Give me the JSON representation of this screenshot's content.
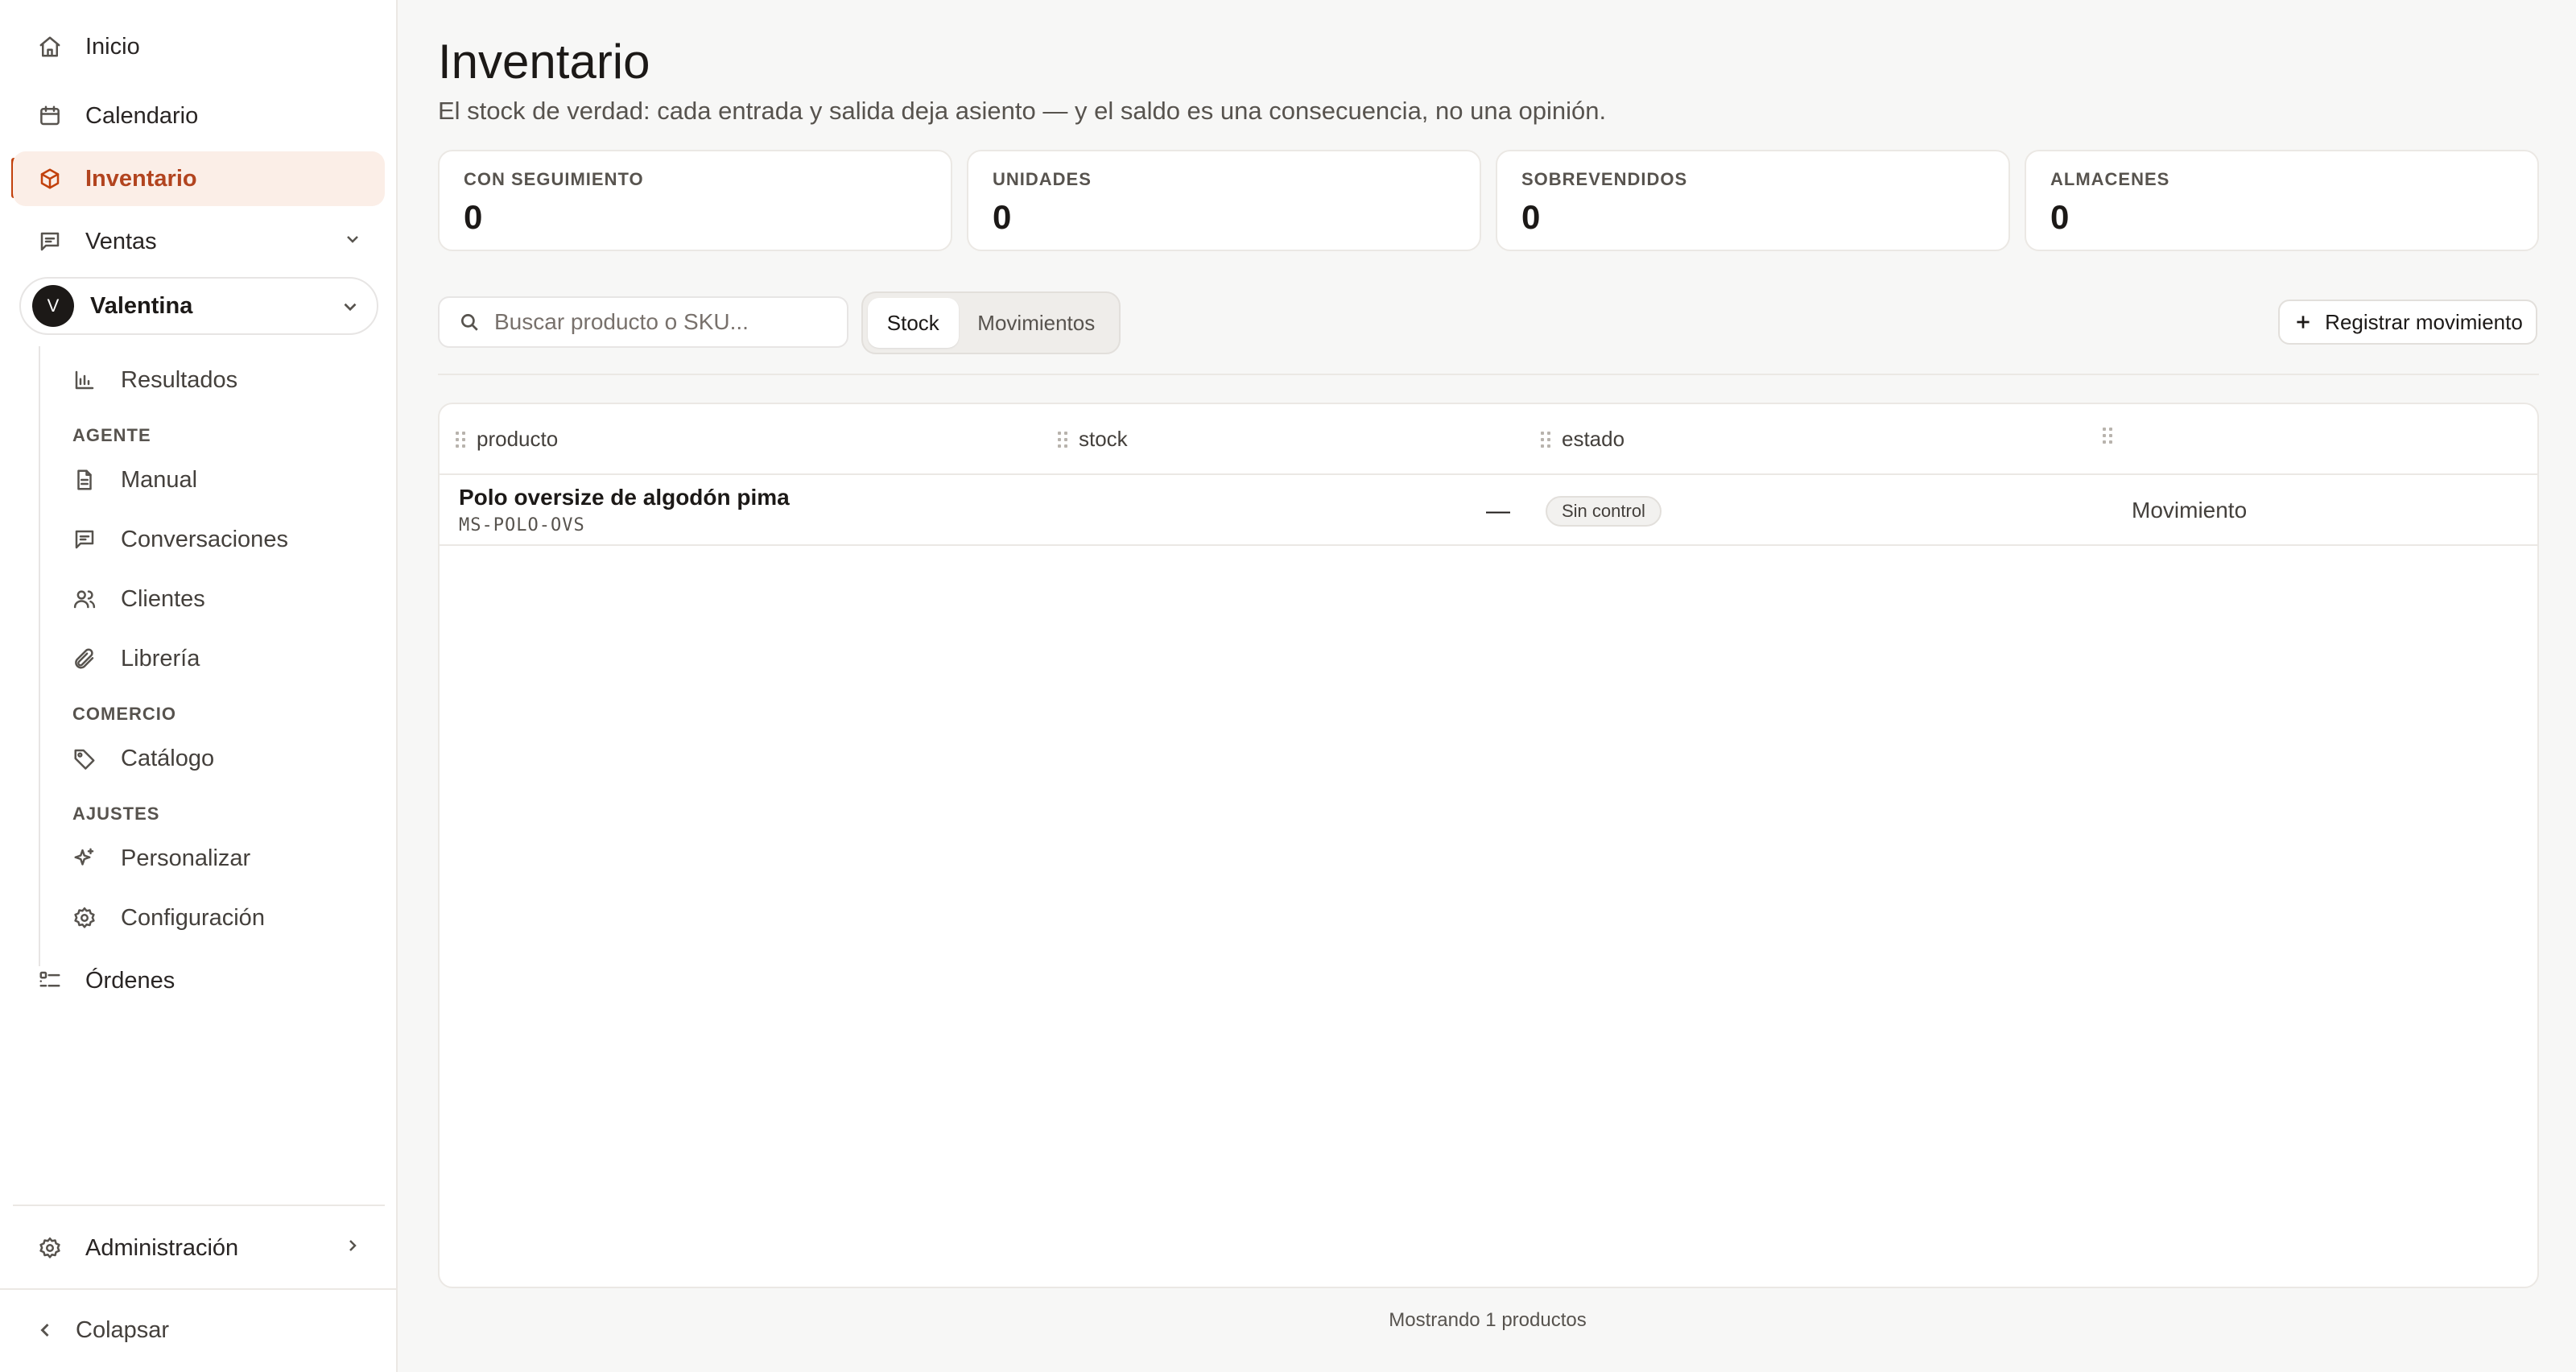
{
  "sidebar": {
    "items": [
      {
        "label": "Inicio",
        "icon": "home-icon"
      },
      {
        "label": "Calendario",
        "icon": "calendar-icon"
      },
      {
        "label": "Inventario",
        "icon": "box-icon",
        "active": true
      },
      {
        "label": "Ventas",
        "icon": "message-icon"
      }
    ],
    "account": {
      "initial": "V",
      "name": "Valentina"
    },
    "sub_items": {
      "resultados": "Resultados",
      "manual": "Manual",
      "conversaciones": "Conversaciones",
      "clientes": "Clientes",
      "libreria": "Librería",
      "catalogo": "Catálogo",
      "personalizar": "Personalizar",
      "configuracion": "Configuración"
    },
    "sections": {
      "agente": "AGENTE",
      "comercio": "COMERCIO",
      "ajustes": "AJUSTES"
    },
    "ordenes": "Órdenes",
    "administracion": "Administración",
    "colapsar": "Colapsar"
  },
  "header": {
    "title": "Inventario",
    "subtitle": "El stock de verdad: cada entrada y salida deja asiento — y el saldo es una consecuencia, no una opinión."
  },
  "stats": [
    {
      "label": "CON SEGUIMIENTO",
      "value": "0"
    },
    {
      "label": "UNIDADES",
      "value": "0"
    },
    {
      "label": "SOBREVENDIDOS",
      "value": "0"
    },
    {
      "label": "ALMACENES",
      "value": "0"
    }
  ],
  "toolbar": {
    "search_placeholder": "Buscar producto o SKU...",
    "tabs": [
      "Stock",
      "Movimientos"
    ],
    "register_label": "Registrar movimiento"
  },
  "table": {
    "columns": [
      "producto",
      "stock",
      "estado",
      ""
    ],
    "rows": [
      {
        "name": "Polo oversize de algodón pima",
        "sku": "MS-POLO-OVS",
        "stock": "—",
        "status": "Sin control",
        "action": "Movimiento"
      }
    ]
  },
  "footer": {
    "text": "Mostrando 1 productos"
  },
  "colors": {
    "accent": "#c2410c",
    "active_bg": "#fbeee7",
    "background": "#f7f7f6"
  }
}
